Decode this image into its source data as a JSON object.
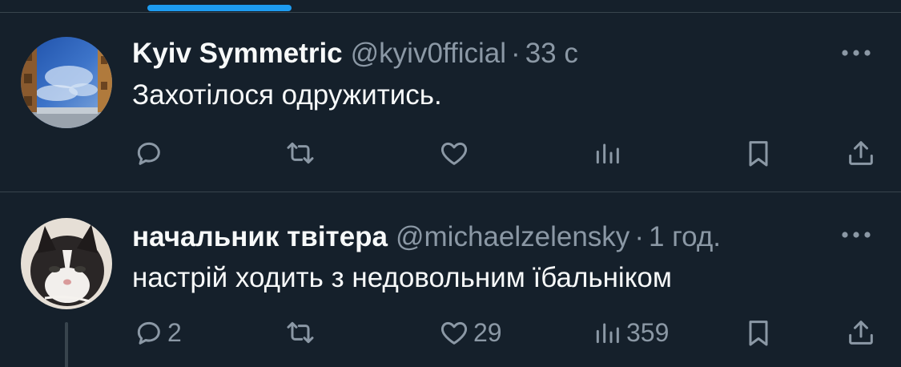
{
  "tweets": [
    {
      "display_name": "Kyiv Symmetric",
      "handle": "@kyiv0fficial",
      "separator": "·",
      "time": "33 с",
      "text": "Захотілося одружитись.",
      "reply_count": "",
      "retweet_count": "",
      "like_count": "",
      "view_count": ""
    },
    {
      "display_name": "начальник твітера",
      "handle": "@michaelzelensky",
      "separator": "·",
      "time": "1 год.",
      "text": "настрій ходить з недовольним їбальніком",
      "reply_count": "2",
      "retweet_count": "",
      "like_count": "29",
      "view_count": "359"
    }
  ],
  "colors": {
    "background": "#15202b",
    "text": "#f7f9f9",
    "muted": "#8b98a5",
    "accent": "#1d9bf0",
    "divider": "#38444d"
  },
  "icons": {
    "reply": "reply-icon",
    "retweet": "retweet-icon",
    "like": "heart-icon",
    "views": "views-chart-icon",
    "bookmark": "bookmark-icon",
    "share": "share-icon",
    "more": "more-dots-icon"
  }
}
